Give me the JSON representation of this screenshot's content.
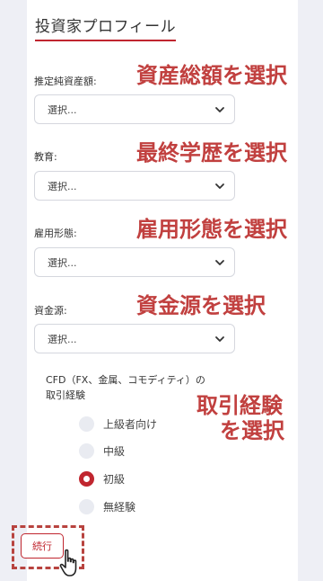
{
  "profile": {
    "title": "投資家プロフィール"
  },
  "fields": [
    {
      "label": "推定純資産額:",
      "value": "選択...",
      "annotation": "資産総額を選択"
    },
    {
      "label": "教育:",
      "value": "選択...",
      "annotation": "最終学歴を選択"
    },
    {
      "label": "雇用形態:",
      "value": "選択...",
      "annotation": "雇用形態を選択"
    },
    {
      "label": "資金源:",
      "value": "選択...",
      "annotation": "資金源を選択"
    }
  ],
  "cfd": {
    "label_line1": "CFD（FX、金属、コモディティ）の",
    "label_line2": "取引経験",
    "annotation_line1": "取引経験",
    "annotation_line2": "を選択",
    "options": [
      {
        "label": "上級者向け",
        "checked": false
      },
      {
        "label": "中級",
        "checked": false
      },
      {
        "label": "初級",
        "checked": true
      },
      {
        "label": "無経験",
        "checked": false
      }
    ]
  },
  "actions": {
    "next_label": "続行"
  },
  "colors": {
    "accent": "#c0262f",
    "annotation": "#c1403f",
    "background": "#eeeff5",
    "card": "#ffffff"
  },
  "icons": {
    "select_arrow": "chevron-down-icon",
    "pointer": "hand-cursor-icon"
  }
}
